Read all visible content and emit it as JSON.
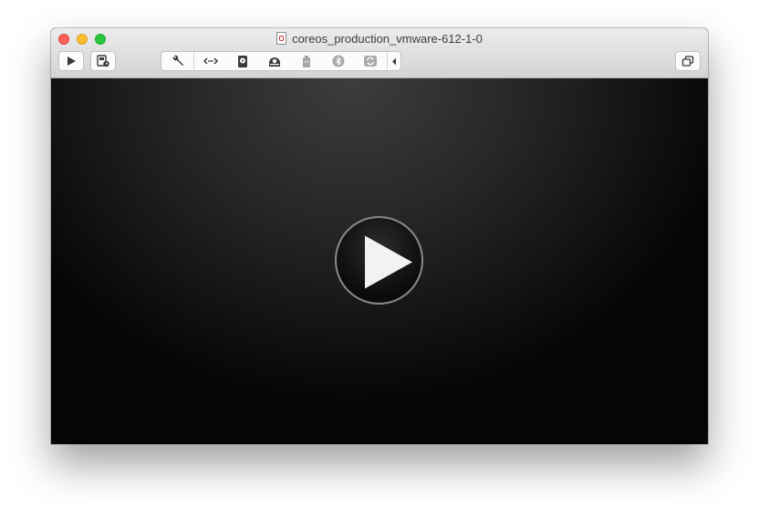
{
  "window": {
    "title": "coreos_production_vmware-612-1-0"
  },
  "toolbar": {
    "left_buttons": [
      {
        "name": "play-icon"
      },
      {
        "name": "snapshot-icon"
      }
    ],
    "device_icons": [
      {
        "name": "wrench-icon",
        "enabled": true
      },
      {
        "name": "network-icon",
        "enabled": true
      },
      {
        "name": "hard-disk-icon",
        "enabled": true
      },
      {
        "name": "cd-dvd-icon",
        "enabled": true
      },
      {
        "name": "usb-icon",
        "enabled": false
      },
      {
        "name": "bluetooth-icon",
        "enabled": false
      },
      {
        "name": "sharing-icon",
        "enabled": false
      }
    ],
    "right_buttons": [
      {
        "name": "restore-window-icon"
      }
    ]
  },
  "colors": {
    "close": "#fc5f57",
    "minimize": "#fdbc2e",
    "zoom": "#28c840",
    "icon": "#3a3a3a",
    "icon_disabled": "#a9a9a9"
  }
}
